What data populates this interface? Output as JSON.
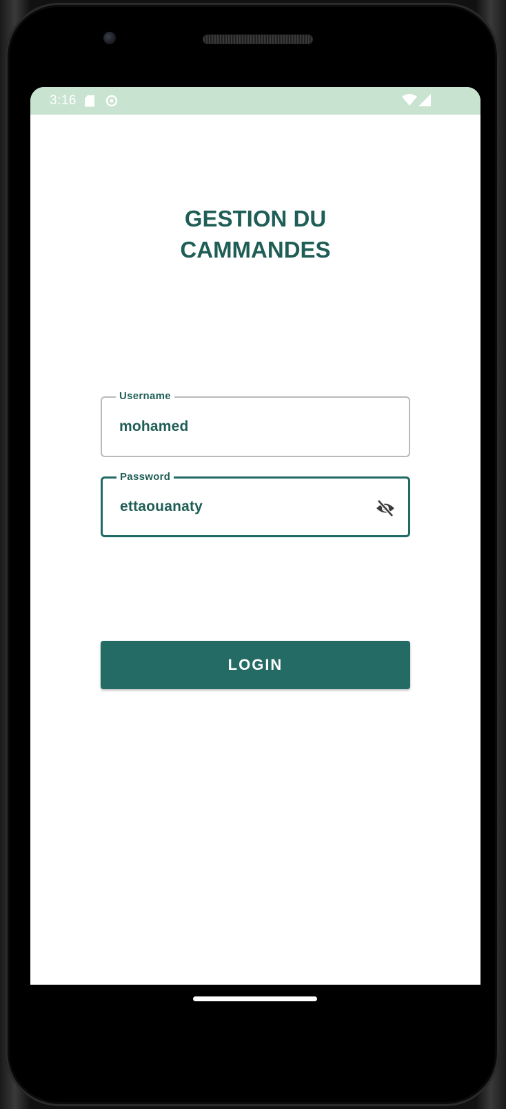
{
  "status_bar": {
    "time": "3:16",
    "background_color": "#c8e3cf",
    "icons": [
      "sd-card-icon",
      "settings-icon",
      "wifi-icon",
      "cellular-signal-icon"
    ]
  },
  "app": {
    "title_line1": "GESTION DU",
    "title_line2": "CAMMANDES",
    "primary_color": "#236b64"
  },
  "form": {
    "username": {
      "label": "Username",
      "value": "mohamed"
    },
    "password": {
      "label": "Password",
      "value": "ettaouanaty",
      "visibility_icon": "visibility-off-icon"
    },
    "login_label": "LOGIN"
  }
}
